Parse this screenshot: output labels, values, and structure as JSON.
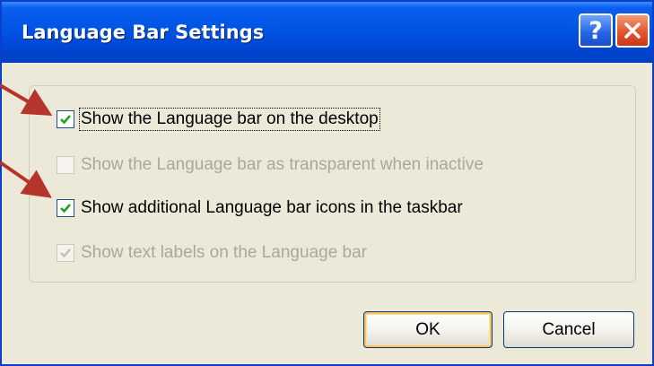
{
  "window": {
    "title": "Language Bar Settings",
    "help_glyph": "?",
    "help_icon": "question-mark-icon",
    "close_icon": "close-x-icon"
  },
  "options": [
    {
      "label": "Show the Language bar on the desktop",
      "checked": true,
      "enabled": true,
      "focused": true
    },
    {
      "label": "Show the Language bar as transparent when inactive",
      "checked": false,
      "enabled": false
    },
    {
      "label": "Show additional Language bar icons in the taskbar",
      "checked": true,
      "enabled": true
    },
    {
      "label": "Show text labels on the Language bar",
      "checked": true,
      "enabled": false
    }
  ],
  "buttons": {
    "ok": "OK",
    "cancel": "Cancel"
  },
  "annotation": {
    "arrow_color": "#b5352b"
  },
  "colors": {
    "title_bar": "#0054e3",
    "dialog_background": "#ece9d8",
    "check_green": "#21a121",
    "disabled_text": "#aca899"
  }
}
